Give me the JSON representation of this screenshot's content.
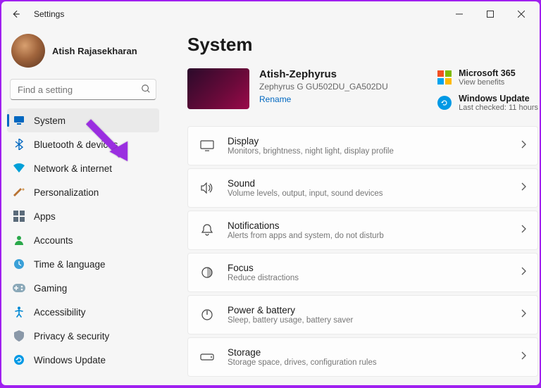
{
  "titlebar": {
    "title": "Settings"
  },
  "profile": {
    "name": "Atish Rajasekharan"
  },
  "search": {
    "placeholder": "Find a setting"
  },
  "nav": [
    {
      "id": "system",
      "label": "System",
      "active": true
    },
    {
      "id": "bluetooth",
      "label": "Bluetooth & devices"
    },
    {
      "id": "network",
      "label": "Network & internet"
    },
    {
      "id": "personalization",
      "label": "Personalization"
    },
    {
      "id": "apps",
      "label": "Apps"
    },
    {
      "id": "accounts",
      "label": "Accounts"
    },
    {
      "id": "time",
      "label": "Time & language"
    },
    {
      "id": "gaming",
      "label": "Gaming"
    },
    {
      "id": "accessibility",
      "label": "Accessibility"
    },
    {
      "id": "privacy",
      "label": "Privacy & security"
    },
    {
      "id": "update",
      "label": "Windows Update"
    }
  ],
  "main": {
    "heading": "System",
    "device": {
      "name": "Atish-Zephyrus",
      "model": "Zephyrus G GU502DU_GA502DU",
      "rename": "Rename"
    },
    "promo": {
      "ms365": {
        "title": "Microsoft 365",
        "sub": "View benefits"
      },
      "update": {
        "title": "Windows Update",
        "sub": "Last checked: 11 hours"
      }
    },
    "cards": [
      {
        "id": "display",
        "title": "Display",
        "sub": "Monitors, brightness, night light, display profile"
      },
      {
        "id": "sound",
        "title": "Sound",
        "sub": "Volume levels, output, input, sound devices"
      },
      {
        "id": "notifications",
        "title": "Notifications",
        "sub": "Alerts from apps and system, do not disturb"
      },
      {
        "id": "focus",
        "title": "Focus",
        "sub": "Reduce distractions"
      },
      {
        "id": "power",
        "title": "Power & battery",
        "sub": "Sleep, battery usage, battery saver"
      },
      {
        "id": "storage",
        "title": "Storage",
        "sub": "Storage space, drives, configuration rules"
      }
    ]
  },
  "colors": {
    "accent": "#0067c0"
  }
}
